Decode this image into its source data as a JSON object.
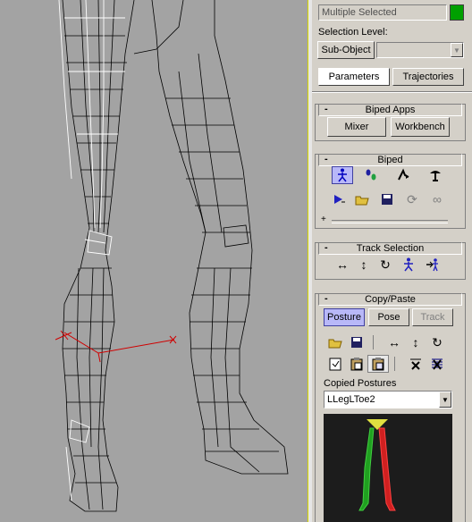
{
  "selection": {
    "name_value": "Multiple Selected",
    "swatch_color": "#00a000"
  },
  "selection_level": {
    "label": "Selection Level:",
    "sub_object_label": "Sub-Object",
    "dropdown_value": ""
  },
  "tabs": [
    {
      "label": "Parameters",
      "active": true
    },
    {
      "label": "Trajectories",
      "active": false
    }
  ],
  "rollouts": {
    "biped_apps": {
      "title": "Biped Apps",
      "mixer_label": "Mixer",
      "workbench_label": "Workbench"
    },
    "biped": {
      "title": "Biped",
      "plus": "+"
    },
    "track_selection": {
      "title": "Track Selection"
    },
    "copy_paste": {
      "title": "Copy/Paste",
      "mode_buttons": [
        {
          "label": "Posture",
          "active": true
        },
        {
          "label": "Pose",
          "active": false
        },
        {
          "label": "Track",
          "disabled": true
        }
      ],
      "copied_postures_label": "Copied Postures",
      "copied_postures_value": "LLegLToe2"
    }
  },
  "colors": {
    "viewport_bg": "#a3a3a3",
    "panel_bg": "#d4d0c8",
    "active_button": "#b8b8f8",
    "preview_bg": "#1c1c1c"
  }
}
